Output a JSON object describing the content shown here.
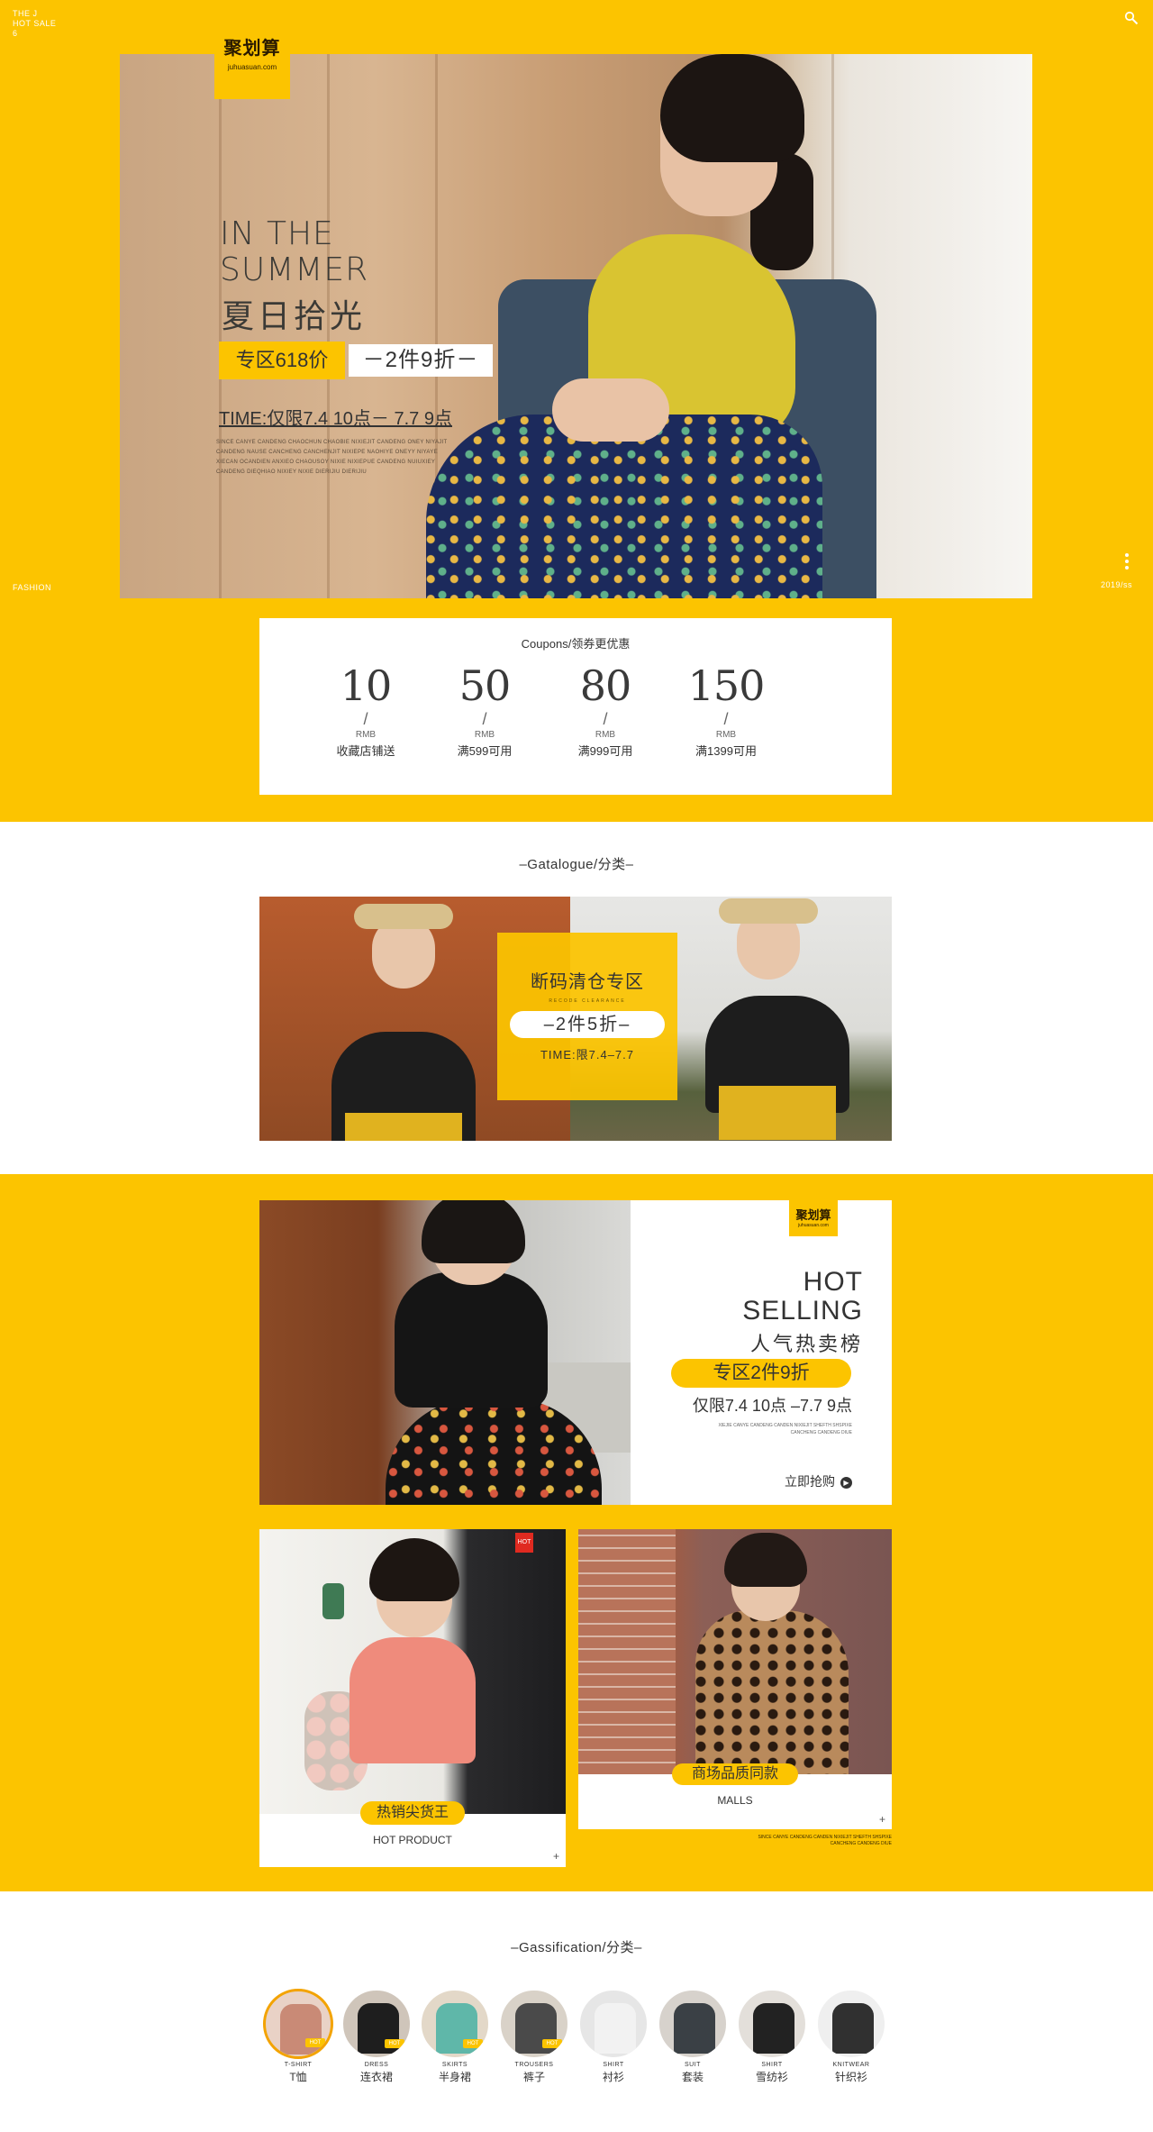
{
  "colors": {
    "accent": "#fcc400",
    "dark": "#333333",
    "white": "#ffffff"
  },
  "corner": {
    "top_left": [
      "THE J",
      "HOT SALE",
      "6"
    ],
    "bottom_left": "FASHION",
    "bottom_right": "2019/ss"
  },
  "hero": {
    "logo_cn": "聚划算",
    "logo_url": "juhuasuan.com",
    "title_line1": "IN THE",
    "title_line2": "SUMMER",
    "title_cn": "夏日拾光",
    "badge": "专区618价",
    "discount": "－2件9折－",
    "time": "TIME:仅限7.4 10点－ 7.7 9点",
    "fine_print": "SINCE CANYE CANDENG CHAOCHUN CHAOBIE NIXIEJIT CANDENG ONEY NIYAJIT CANDENG NAUSE CANCHENG CANCHENJIT NIXIEPE NAOHIYE ONEYY NIYAYE XIECAN OCANDIEN ANXIEO CHAOUSOY NIXIE NIXIEPUE CANDENG NUIUXIEY CANDENG DIEQHIAO NIXIEY NIXIE DIERIJIU DIERIJIU"
  },
  "coupons": {
    "title": "Coupons/领券更优惠",
    "items": [
      {
        "value": "10",
        "currency": "RMB",
        "desc": "收藏店铺送"
      },
      {
        "value": "50",
        "currency": "RMB",
        "desc": "满599可用"
      },
      {
        "value": "80",
        "currency": "RMB",
        "desc": "满999可用"
      },
      {
        "value": "150",
        "currency": "RMB",
        "desc": "满1399可用"
      }
    ]
  },
  "catalogue": {
    "heading": "–Gatalogue/分类–",
    "box_title": "断码清仓专区",
    "box_sub": "RECODE CLEARANCE",
    "box_discount": "–2件5折–",
    "box_time": "TIME:限7.4–7.7"
  },
  "hot_selling": {
    "logo_cn": "聚划算",
    "logo_url": "juhuasuan.com",
    "en_line1": "HOT",
    "en_line2": "SELLING",
    "cn_title": "人气热卖榜",
    "badge": "专区2件9折",
    "time": "仅限7.4 10点 –7.7 9点",
    "fine_print": "XIEJIE CANYE CANDENG CANDEN NIXIEJIT SHEFTH SHSPIXE CANCHENG CANDENG DIUE",
    "buy": "立即抢购"
  },
  "products": [
    {
      "hot": "HOT",
      "label": "热销尖货王",
      "sub": "HOT PRODUCT",
      "plus": "+"
    },
    {
      "label": "商场品质同款",
      "sub": "MALLS",
      "plus": "+",
      "fine_print": "SINCE CANYE CANDENG CANDEN NIXIEJIT SHEFTH SHSPIXE CANCHENG CANDENG DIUE"
    }
  ],
  "classification": {
    "heading": "–Gassification/分类–",
    "items": [
      {
        "en": "T-SHIRT",
        "cn": "T恤",
        "hot": "HOT",
        "color": "#c98a76",
        "bg": "#e9d2c6"
      },
      {
        "en": "DRESS",
        "cn": "连衣裙",
        "hot": "HOT",
        "color": "#1e1e1e",
        "bg": "#cfc5ba"
      },
      {
        "en": "SKIRTS",
        "cn": "半身裙",
        "hot": "HOT",
        "color": "#5fb7a9",
        "bg": "#e3d8c8"
      },
      {
        "en": "TROUSERS",
        "cn": "裤子",
        "hot": "HOT",
        "color": "#4a4a4a",
        "bg": "#d9d2c8"
      },
      {
        "en": "SHIRT",
        "cn": "衬衫",
        "hot": "",
        "color": "#f2f2f2",
        "bg": "#e6e6e6"
      },
      {
        "en": "SUIT",
        "cn": "套装",
        "hot": "",
        "color": "#3a4045",
        "bg": "#d7d2cc"
      },
      {
        "en": "SHIRT",
        "cn": "雪纺衫",
        "hot": "",
        "color": "#222222",
        "bg": "#e3dfda"
      },
      {
        "en": "KNITWEAR",
        "cn": "针织衫",
        "hot": "",
        "color": "#303030",
        "bg": "#efefef"
      }
    ]
  }
}
